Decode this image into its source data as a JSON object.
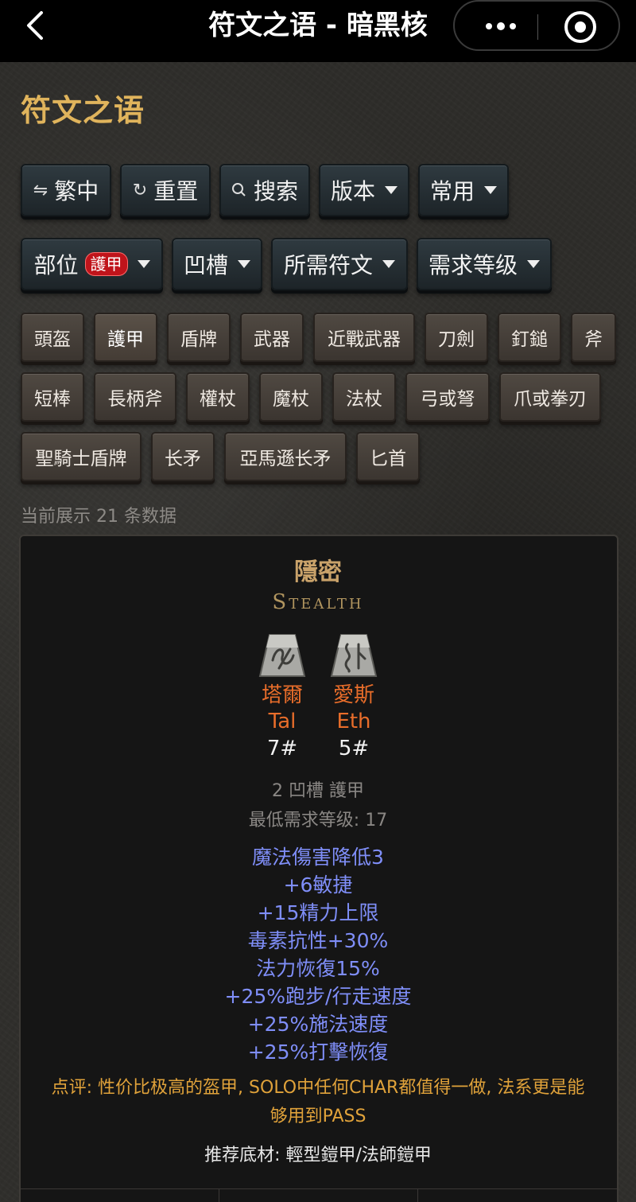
{
  "nav": {
    "title": "符文之语 - 暗黑核"
  },
  "page": {
    "title": "符文之语"
  },
  "toolbar": {
    "buttons": [
      {
        "label": "繁中",
        "icon": "swap-icon"
      },
      {
        "label": "重置",
        "icon": "refresh-icon"
      },
      {
        "label": "搜索",
        "icon": "search-icon"
      },
      {
        "label": "版本",
        "icon": "caret-down-icon"
      },
      {
        "label": "常用",
        "icon": "caret-down-icon"
      }
    ],
    "filters": [
      {
        "label": "部位",
        "badge": "護甲"
      },
      {
        "label": "凹槽"
      },
      {
        "label": "所需符文"
      },
      {
        "label": "需求等级"
      }
    ]
  },
  "categories": [
    "頭盔",
    "護甲",
    "盾牌",
    "武器",
    "近戰武器",
    "刀劍",
    "釘鎚",
    "斧",
    "短棒",
    "長柄斧",
    "權杖",
    "魔杖",
    "法杖",
    "弓或弩",
    "爪或拳刃",
    "聖騎士盾牌",
    "长矛",
    "亞馬遜长矛",
    "匕首"
  ],
  "selected_category": "護甲",
  "count_text": "当前展示 21 条数据",
  "runeword": {
    "name_cn": "隱密",
    "name_en": "Stealth",
    "runes": [
      {
        "cn": "塔爾",
        "en": "Tal",
        "num": "7#"
      },
      {
        "cn": "愛斯",
        "en": "Eth",
        "num": "5#"
      }
    ],
    "sockets_type": "2 凹槽 護甲",
    "min_level": "最低需求等级: 17",
    "properties": [
      "魔法傷害降低3",
      "+6敏捷",
      "+15精力上限",
      "毒素抗性+30%",
      "法力恢復15%",
      "+25%跑步/行走速度",
      "+25%施法速度",
      "+25%打擊恢復"
    ],
    "comment": "点评: 性价比极高的盔甲, SOLO中任何CHAR都值得一做, 法系更是能够用到PASS",
    "base": "推荐底材: 輕型鎧甲/法師鎧甲"
  },
  "colors": {
    "title_gold": "#e0b45c",
    "rune_orange": "#e86d2a",
    "property_blue": "#7f8ef8",
    "comment_orange": "#e0a23a",
    "badge_red": "#c0141b"
  }
}
